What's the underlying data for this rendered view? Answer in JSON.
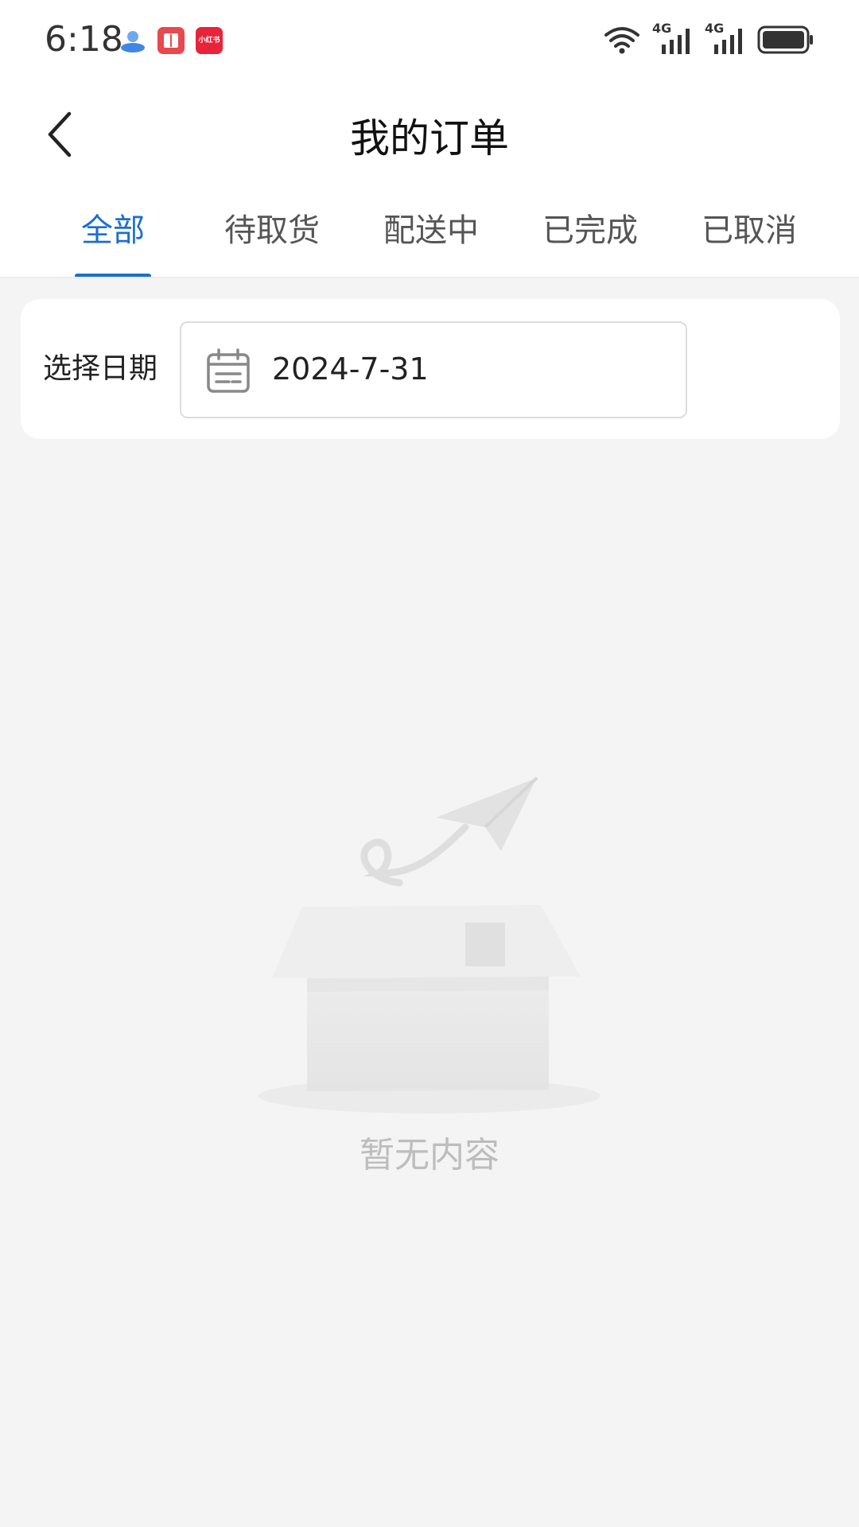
{
  "status_bar": {
    "time": "6:18",
    "app_icon_3_text": "小红书",
    "network_1": "4G",
    "network_2": "4G"
  },
  "header": {
    "title": "我的订单"
  },
  "tabs": [
    {
      "label": "全部",
      "active": true
    },
    {
      "label": "待取货",
      "active": false
    },
    {
      "label": "配送中",
      "active": false
    },
    {
      "label": "已完成",
      "active": false
    },
    {
      "label": "已取消",
      "active": false
    }
  ],
  "filter": {
    "label": "选择日期",
    "date_value": "2024-7-31"
  },
  "empty_state": {
    "text": "暂无内容"
  },
  "colors": {
    "accent": "#1b6fcf",
    "background": "#f4f4f4",
    "card": "#ffffff",
    "empty_text": "#bdbdbd"
  },
  "icons": {
    "back": "chevron-left-icon",
    "calendar": "calendar-icon",
    "empty": "empty-box-icon"
  }
}
